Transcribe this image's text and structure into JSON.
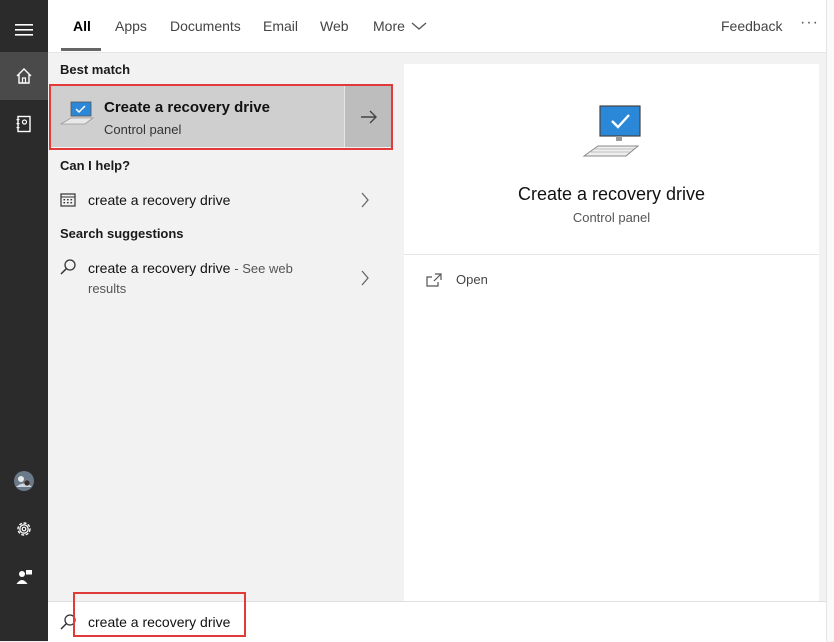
{
  "tabs": [
    {
      "label": "All"
    },
    {
      "label": "Apps"
    },
    {
      "label": "Documents"
    },
    {
      "label": "Email"
    },
    {
      "label": "Web"
    },
    {
      "label": "More"
    }
  ],
  "header": {
    "feedback": "Feedback",
    "more_options": "···"
  },
  "sections": {
    "best_match": "Best match",
    "can_i_help": "Can I help?",
    "search_suggestions": "Search suggestions"
  },
  "best_match": {
    "title": "Create a recovery drive",
    "subtitle": "Control panel"
  },
  "help_item": {
    "label": "create a recovery drive"
  },
  "suggestion": {
    "label": "create a recovery drive",
    "suffix": "- See web",
    "suffix2": "results"
  },
  "preview": {
    "title": "Create a recovery drive",
    "subtitle": "Control panel",
    "open_label": "Open"
  },
  "search": {
    "query": "create a recovery drive"
  },
  "colors": {
    "highlight": "#e03a3a",
    "rail": "#2b2b2b",
    "accent": "#2b88d8"
  }
}
